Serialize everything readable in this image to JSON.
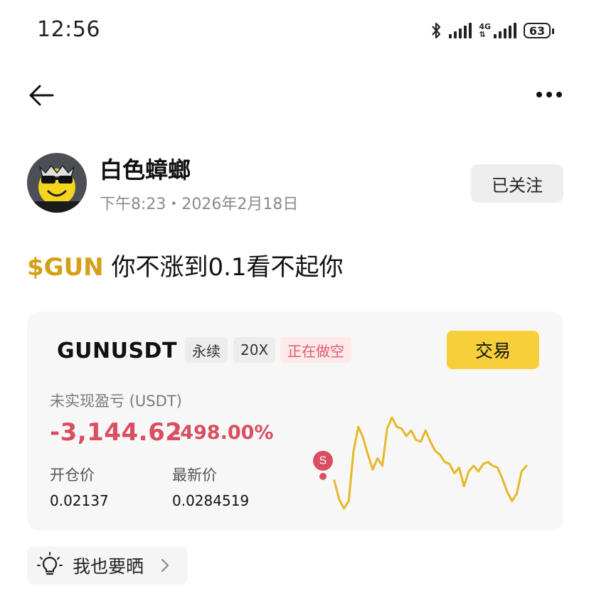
{
  "status_bar": {
    "time": "12:56",
    "network": "4G",
    "battery": "63"
  },
  "post": {
    "author": "白色蟑螂",
    "meta": "下午8:23・2026年2月18日",
    "follow_label": "已关注",
    "ticker": "$GUN",
    "text": " 你不涨到0.1看不起你"
  },
  "position": {
    "pair": "GUNUSDT",
    "tags": [
      "永续",
      "20X",
      "正在做空"
    ],
    "trade_label": "交易",
    "pnl_label": "未实现盈亏 (USDT)",
    "pnl_amount": "-3,144.62",
    "pnl_percent": "-498.00%",
    "open_label": "开仓价",
    "open_price": "0.02137",
    "last_label": "最新价",
    "last_price": "0.0284519",
    "marker_label": "S",
    "colors": {
      "accent": "#f7cf3b",
      "loss": "#d84f61",
      "line": "#e6b82a",
      "ticker": "#d4a017"
    }
  },
  "chart_data": {
    "type": "line",
    "values": [
      42,
      22,
      12,
      20,
      74,
      100,
      88,
      70,
      54,
      66,
      58,
      98,
      110,
      100,
      98,
      90,
      96,
      86,
      84,
      96,
      84,
      74,
      70,
      62,
      60,
      50,
      56,
      36,
      52,
      58,
      52,
      60,
      62,
      58,
      56,
      44,
      30,
      20,
      28,
      52,
      58
    ]
  },
  "footer": {
    "share_label": "我也要晒"
  }
}
